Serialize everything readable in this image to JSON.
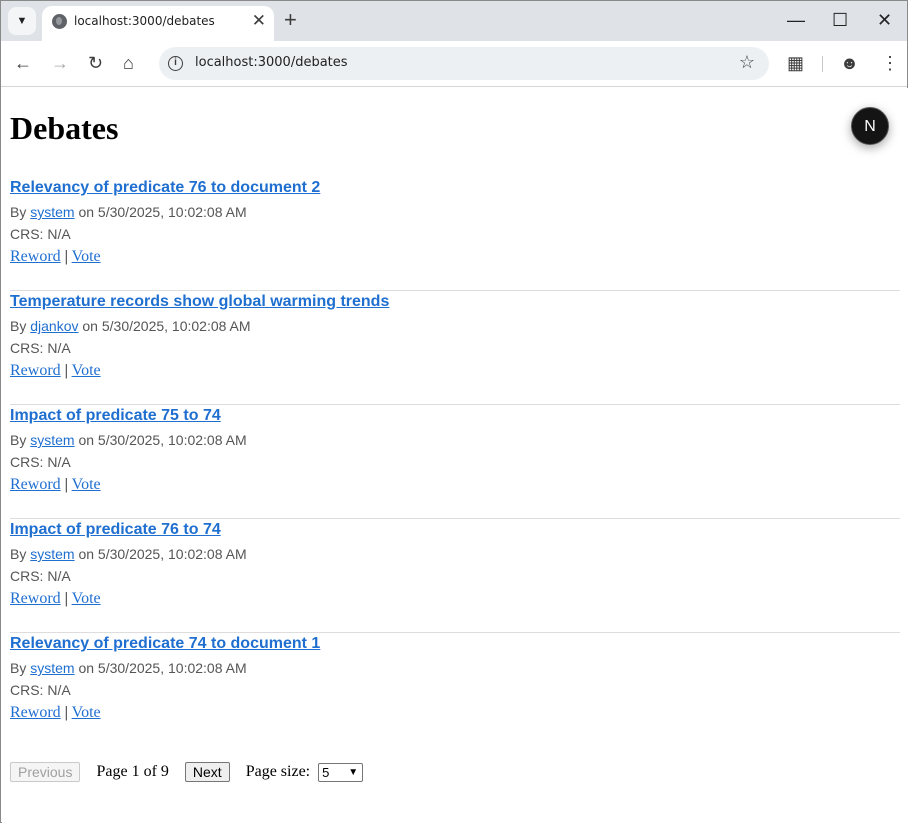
{
  "browser": {
    "tab_title": "localhost:3000/debates",
    "url": "localhost:3000/debates"
  },
  "page": {
    "title": "Debates",
    "badge": "N"
  },
  "debates": [
    {
      "title": "Relevancy of predicate 76 to document 2",
      "by_prefix": "By",
      "author": "system",
      "on_text": "on 5/30/2025, 10:02:08 AM",
      "crs": "CRS: N/A",
      "reword": "Reword",
      "sep": "|",
      "vote": "Vote"
    },
    {
      "title": "Temperature records show global warming trends",
      "by_prefix": "By",
      "author": "djankov",
      "on_text": "on 5/30/2025, 10:02:08 AM",
      "crs": "CRS: N/A",
      "reword": "Reword",
      "sep": "|",
      "vote": "Vote"
    },
    {
      "title": "Impact of predicate 75 to 74",
      "by_prefix": "By",
      "author": "system",
      "on_text": "on 5/30/2025, 10:02:08 AM",
      "crs": "CRS: N/A",
      "reword": "Reword",
      "sep": "|",
      "vote": "Vote"
    },
    {
      "title": "Impact of predicate 76 to 74",
      "by_prefix": "By",
      "author": "system",
      "on_text": "on 5/30/2025, 10:02:08 AM",
      "crs": "CRS: N/A",
      "reword": "Reword",
      "sep": "|",
      "vote": "Vote"
    },
    {
      "title": "Relevancy of predicate 74 to document 1",
      "by_prefix": "By",
      "author": "system",
      "on_text": "on 5/30/2025, 10:02:08 AM",
      "crs": "CRS: N/A",
      "reword": "Reword",
      "sep": "|",
      "vote": "Vote"
    }
  ],
  "pagination": {
    "previous": "Previous",
    "page_info": "Page 1 of 9",
    "next": "Next",
    "page_size_label": "Page size:",
    "page_size_value": "5"
  },
  "icons": {
    "tab_search": "chevron-down-icon",
    "favicon": "globe-icon",
    "back": "back-arrow-icon",
    "forward": "forward-arrow-icon",
    "reload": "reload-icon",
    "home": "home-icon",
    "site_info": "info-icon",
    "bookmark": "star-icon",
    "extensions": "puzzle-icon",
    "profile": "profile-icon",
    "menu": "kebab-menu-icon"
  },
  "colors": {
    "link": "#1f6fd0",
    "muted_text": "#555555",
    "badge_bg": "#141414"
  }
}
